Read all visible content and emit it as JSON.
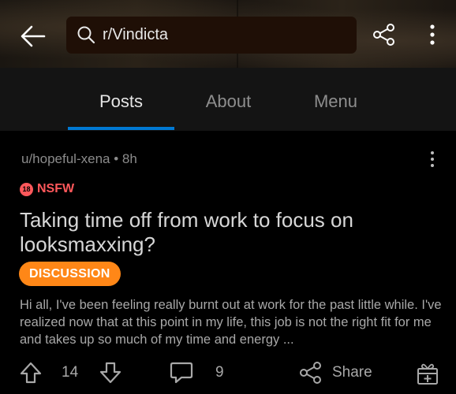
{
  "header": {
    "search_text": "r/Vindicta",
    "back_icon": "arrow-left-icon",
    "share_icon": "share-icon",
    "more_icon": "more-vertical-icon"
  },
  "tabs": [
    {
      "label": "Posts",
      "active": true
    },
    {
      "label": "About",
      "active": false
    },
    {
      "label": "Menu",
      "active": false
    }
  ],
  "post": {
    "author": "u/hopeful-xena",
    "separator": "•",
    "age": "8h",
    "nsfw_badge_icon_text": "18",
    "nsfw_label": "NSFW",
    "title": "Taking time off from work to focus on looksmaxxing?",
    "flair": "DISCUSSION",
    "body": "Hi all, I've been feeling really burnt out at work for the past little while. I've realized now that at this point in my life, this job is not the right fit for me and takes up so much of my time and energy ..."
  },
  "actions": {
    "vote_count": "14",
    "comment_count": "9",
    "share_label": "Share"
  },
  "colors": {
    "accent_blue": "#0079d3",
    "nsfw_red": "#ff585b",
    "flair_orange": "#ff8717",
    "background": "#000000",
    "tab_bar": "#141414"
  }
}
